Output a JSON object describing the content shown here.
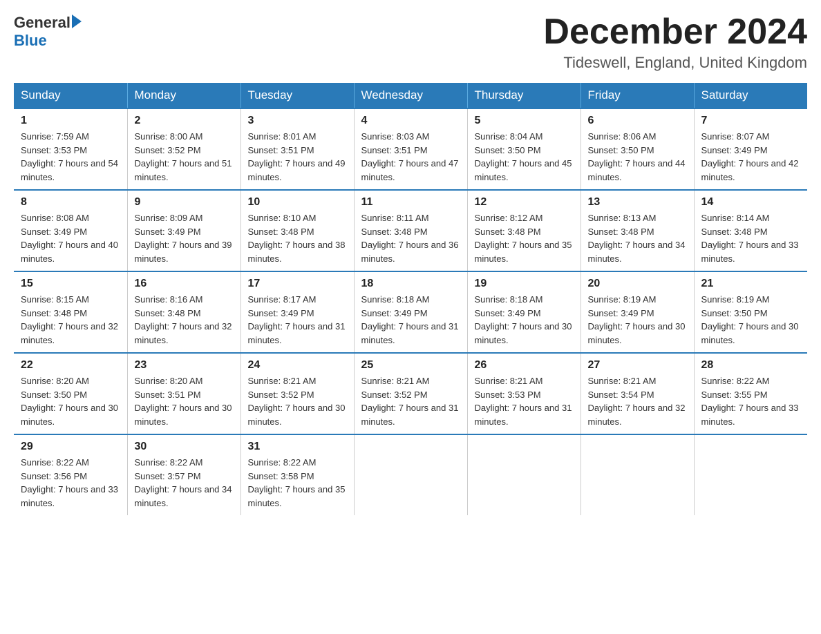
{
  "header": {
    "logo_general": "General",
    "logo_blue": "Blue",
    "month_title": "December 2024",
    "location": "Tideswell, England, United Kingdom"
  },
  "weekdays": [
    "Sunday",
    "Monday",
    "Tuesday",
    "Wednesday",
    "Thursday",
    "Friday",
    "Saturday"
  ],
  "weeks": [
    [
      {
        "day": "1",
        "sunrise": "7:59 AM",
        "sunset": "3:53 PM",
        "daylight": "7 hours and 54 minutes."
      },
      {
        "day": "2",
        "sunrise": "8:00 AM",
        "sunset": "3:52 PM",
        "daylight": "7 hours and 51 minutes."
      },
      {
        "day": "3",
        "sunrise": "8:01 AM",
        "sunset": "3:51 PM",
        "daylight": "7 hours and 49 minutes."
      },
      {
        "day": "4",
        "sunrise": "8:03 AM",
        "sunset": "3:51 PM",
        "daylight": "7 hours and 47 minutes."
      },
      {
        "day": "5",
        "sunrise": "8:04 AM",
        "sunset": "3:50 PM",
        "daylight": "7 hours and 45 minutes."
      },
      {
        "day": "6",
        "sunrise": "8:06 AM",
        "sunset": "3:50 PM",
        "daylight": "7 hours and 44 minutes."
      },
      {
        "day": "7",
        "sunrise": "8:07 AM",
        "sunset": "3:49 PM",
        "daylight": "7 hours and 42 minutes."
      }
    ],
    [
      {
        "day": "8",
        "sunrise": "8:08 AM",
        "sunset": "3:49 PM",
        "daylight": "7 hours and 40 minutes."
      },
      {
        "day": "9",
        "sunrise": "8:09 AM",
        "sunset": "3:49 PM",
        "daylight": "7 hours and 39 minutes."
      },
      {
        "day": "10",
        "sunrise": "8:10 AM",
        "sunset": "3:48 PM",
        "daylight": "7 hours and 38 minutes."
      },
      {
        "day": "11",
        "sunrise": "8:11 AM",
        "sunset": "3:48 PM",
        "daylight": "7 hours and 36 minutes."
      },
      {
        "day": "12",
        "sunrise": "8:12 AM",
        "sunset": "3:48 PM",
        "daylight": "7 hours and 35 minutes."
      },
      {
        "day": "13",
        "sunrise": "8:13 AM",
        "sunset": "3:48 PM",
        "daylight": "7 hours and 34 minutes."
      },
      {
        "day": "14",
        "sunrise": "8:14 AM",
        "sunset": "3:48 PM",
        "daylight": "7 hours and 33 minutes."
      }
    ],
    [
      {
        "day": "15",
        "sunrise": "8:15 AM",
        "sunset": "3:48 PM",
        "daylight": "7 hours and 32 minutes."
      },
      {
        "day": "16",
        "sunrise": "8:16 AM",
        "sunset": "3:48 PM",
        "daylight": "7 hours and 32 minutes."
      },
      {
        "day": "17",
        "sunrise": "8:17 AM",
        "sunset": "3:49 PM",
        "daylight": "7 hours and 31 minutes."
      },
      {
        "day": "18",
        "sunrise": "8:18 AM",
        "sunset": "3:49 PM",
        "daylight": "7 hours and 31 minutes."
      },
      {
        "day": "19",
        "sunrise": "8:18 AM",
        "sunset": "3:49 PM",
        "daylight": "7 hours and 30 minutes."
      },
      {
        "day": "20",
        "sunrise": "8:19 AM",
        "sunset": "3:49 PM",
        "daylight": "7 hours and 30 minutes."
      },
      {
        "day": "21",
        "sunrise": "8:19 AM",
        "sunset": "3:50 PM",
        "daylight": "7 hours and 30 minutes."
      }
    ],
    [
      {
        "day": "22",
        "sunrise": "8:20 AM",
        "sunset": "3:50 PM",
        "daylight": "7 hours and 30 minutes."
      },
      {
        "day": "23",
        "sunrise": "8:20 AM",
        "sunset": "3:51 PM",
        "daylight": "7 hours and 30 minutes."
      },
      {
        "day": "24",
        "sunrise": "8:21 AM",
        "sunset": "3:52 PM",
        "daylight": "7 hours and 30 minutes."
      },
      {
        "day": "25",
        "sunrise": "8:21 AM",
        "sunset": "3:52 PM",
        "daylight": "7 hours and 31 minutes."
      },
      {
        "day": "26",
        "sunrise": "8:21 AM",
        "sunset": "3:53 PM",
        "daylight": "7 hours and 31 minutes."
      },
      {
        "day": "27",
        "sunrise": "8:21 AM",
        "sunset": "3:54 PM",
        "daylight": "7 hours and 32 minutes."
      },
      {
        "day": "28",
        "sunrise": "8:22 AM",
        "sunset": "3:55 PM",
        "daylight": "7 hours and 33 minutes."
      }
    ],
    [
      {
        "day": "29",
        "sunrise": "8:22 AM",
        "sunset": "3:56 PM",
        "daylight": "7 hours and 33 minutes."
      },
      {
        "day": "30",
        "sunrise": "8:22 AM",
        "sunset": "3:57 PM",
        "daylight": "7 hours and 34 minutes."
      },
      {
        "day": "31",
        "sunrise": "8:22 AM",
        "sunset": "3:58 PM",
        "daylight": "7 hours and 35 minutes."
      },
      null,
      null,
      null,
      null
    ]
  ]
}
